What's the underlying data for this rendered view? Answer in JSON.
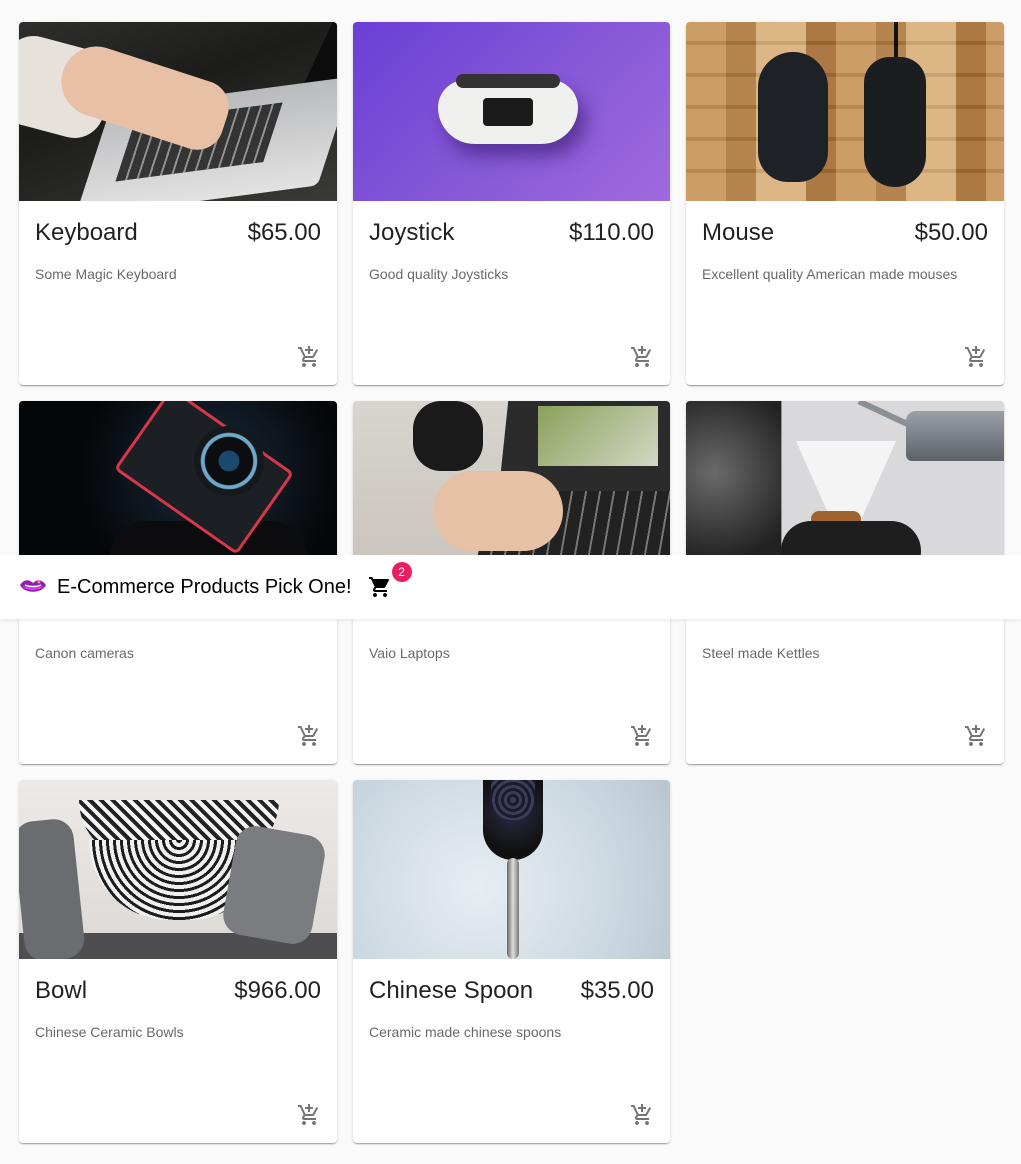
{
  "toolbar": {
    "title": "E-Commerce Products Pick One!",
    "cart_count": "2",
    "logo_icon": "lips-logo-icon",
    "cart_icon": "shopping-cart-icon"
  },
  "colors": {
    "badge": "#e91e63",
    "background": "#fafafa",
    "card": "#ffffff"
  },
  "products": [
    {
      "name": "Keyboard",
      "price": "$65.00",
      "description": "Some Magic Keyboard",
      "image": "laptop-typing-photo"
    },
    {
      "name": "Joystick",
      "price": "$110.00",
      "description": "Good quality Joysticks",
      "image": "game-controller-photo"
    },
    {
      "name": "Mouse",
      "price": "$50.00",
      "description": "Excellent quality American made mouses",
      "image": "computer-mice-photo"
    },
    {
      "name": "",
      "price": "",
      "description": "Canon cameras",
      "image": "camera-photo"
    },
    {
      "name": "",
      "price": "",
      "description": "Vaio Laptops",
      "image": "laptop-photo"
    },
    {
      "name": "",
      "price": "",
      "description": "Steel made Kettles",
      "image": "kettle-photo"
    },
    {
      "name": "Bowl",
      "price": "$966.00",
      "description": "Chinese Ceramic Bowls",
      "image": "ceramic-bowls-photo"
    },
    {
      "name": "Chinese Spoon",
      "price": "$35.00",
      "description": "Ceramic made chinese spoons",
      "image": "spoon-photo"
    }
  ]
}
